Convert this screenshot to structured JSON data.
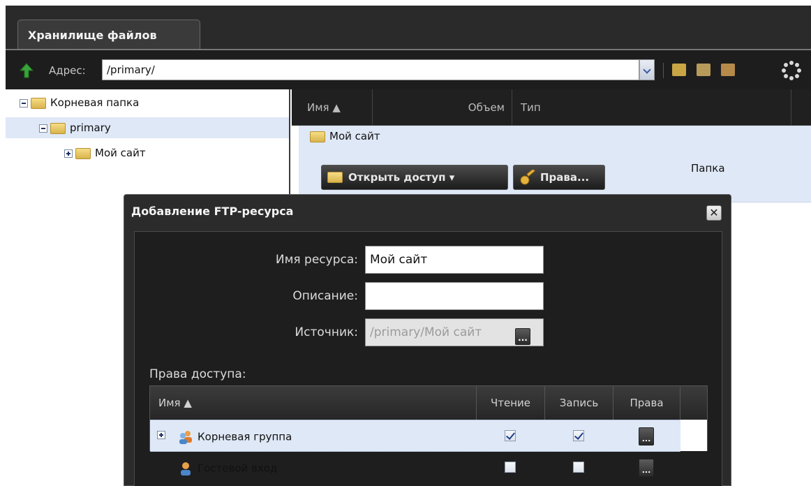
{
  "tab": {
    "label": "Хранилище файлов"
  },
  "toolbar": {
    "address_label": "Адрес:",
    "address_value": "/primary/"
  },
  "tree": {
    "items": [
      {
        "label": "Корневая папка"
      },
      {
        "label": "primary"
      },
      {
        "label": "Мой сайт"
      }
    ]
  },
  "list": {
    "columns": [
      "Имя ▲",
      "Объем",
      "Тип"
    ],
    "row": {
      "name": "Мой сайт",
      "type": "Папка"
    },
    "buttons": {
      "share": "Открыть доступ ▾",
      "rights": "Права..."
    }
  },
  "dialog": {
    "title": "Добавление FTP-ресурса",
    "close": "✕",
    "fields": {
      "name_label": "Имя ресурса:",
      "name_value": "Мой сайт",
      "desc_label": "Описание:",
      "desc_value": "",
      "source_label": "Источник:",
      "source_value": "/primary/Мой сайт"
    },
    "perm_label": "Права доступа:",
    "grid": {
      "columns": [
        "Имя ▲",
        "Чтение",
        "Запись",
        "Права"
      ],
      "rows": [
        {
          "name": "Корневая группа",
          "read": true,
          "write": true
        },
        {
          "name": "Гостевой вход",
          "read": false,
          "write": false
        }
      ]
    },
    "dots": "..."
  },
  "colors": {
    "header_bg": "#2a2a2a",
    "selection": "#dfe8f6",
    "folder": "#d9b34d"
  }
}
